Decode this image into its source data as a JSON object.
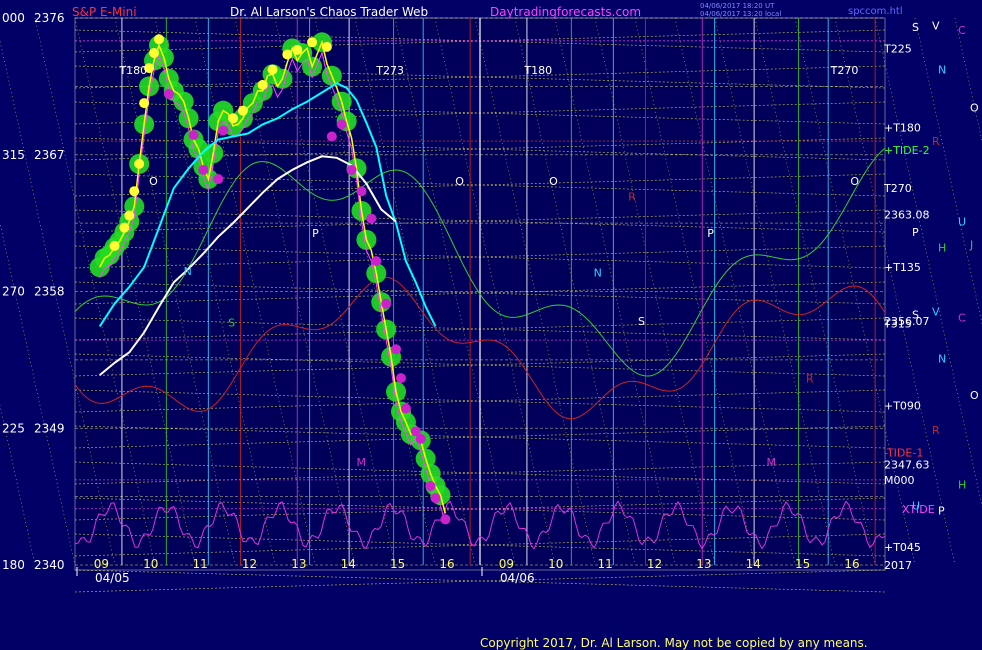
{
  "header": {
    "instrument": "S&P E-Mini",
    "site": "Dr. Al Larson's Chaos Trader Web",
    "url": "Daytradingforecasts.com",
    "stamp1": "04/06/2017 18:20 UT",
    "stamp2": "04/06/2017 13:20 local",
    "file": "spccom.htl"
  },
  "footer": {
    "copyright": "Copyright 2017, Dr. Al Larson. May not be copied by any means."
  },
  "colors": {
    "background": "#000066",
    "price": "#ffff00",
    "ma_fast": "#00ffff",
    "ma_slow": "#ffffff",
    "green_marker": "#22dd22",
    "yellow_marker": "#ffff33",
    "magenta_marker": "#cc22cc",
    "red_line": "#cc2222",
    "green_line": "#33cc33",
    "xtide": "#dd33dd",
    "grid_yellow": "#dddd55"
  },
  "chart_data": {
    "type": "line",
    "y_left_labels": [
      {
        "angle": "000",
        "price": "2376"
      },
      {
        "angle": "315",
        "price": "2367"
      },
      {
        "angle": "270",
        "price": "2358"
      },
      {
        "angle": "225",
        "price": "2349"
      },
      {
        "angle": "180",
        "price": "2340"
      }
    ],
    "ylim": [
      2340,
      2376
    ],
    "days": [
      {
        "date": "04/05",
        "hours": [
          "09",
          "10",
          "11",
          "12",
          "13",
          "14",
          "15",
          "16"
        ]
      },
      {
        "date": "04/06",
        "hours": [
          "09",
          "10",
          "11",
          "12",
          "13",
          "14",
          "15",
          "16"
        ]
      }
    ],
    "right_labels": [
      {
        "text": "T225",
        "price": 2374.0
      },
      {
        "text": "+T180",
        "price": 2368.8
      },
      {
        "text": "+TIDE-2",
        "price": 2367.3
      },
      {
        "text": "T270",
        "price": 2364.8
      },
      {
        "text": "2363.08",
        "price": 2363.08
      },
      {
        "text": "+T135",
        "price": 2359.6
      },
      {
        "text": "2356.07",
        "price": 2356.07
      },
      {
        "text": "T315",
        "price": 2355.9
      },
      {
        "text": "+T090",
        "price": 2350.5
      },
      {
        "text": "-TIDE-1",
        "price": 2347.4
      },
      {
        "text": "2347.63",
        "price": 2346.6
      },
      {
        "text": "M000",
        "price": 2345.6
      },
      {
        "text": "XTIDE",
        "price": 2343.7
      },
      {
        "text": "+T045",
        "price": 2341.2
      },
      {
        "text": "2017",
        "price": 2340.0
      }
    ],
    "planet_labels": [
      {
        "text": "V",
        "color": "#ffffff",
        "price": 2375.5
      },
      {
        "text": "C",
        "color": "#cc33cc",
        "price": 2375.2
      },
      {
        "text": "S",
        "color": "#ffffff",
        "price": 2375.4
      },
      {
        "text": "N",
        "color": "#33ccff",
        "price": 2372.6
      },
      {
        "text": "O",
        "color": "#ffffff",
        "price": 2370.1
      },
      {
        "text": "R",
        "color": "#cc2222",
        "price": 2367.9
      },
      {
        "text": "U",
        "color": "#33ccff",
        "price": 2362.6
      },
      {
        "text": "P",
        "color": "#ffffff",
        "price": 2361.9
      },
      {
        "text": "H",
        "color": "#33cc33",
        "price": 2360.9
      },
      {
        "text": "J",
        "color": "#33cc33",
        "price": 2361.1
      },
      {
        "text": "V",
        "color": "#33ccff",
        "price": 2356.7
      },
      {
        "text": "C",
        "color": "#cc33cc",
        "price": 2356.3
      },
      {
        "text": "S",
        "color": "#ffffff",
        "price": 2356.5
      },
      {
        "text": "N",
        "color": "#33ccff",
        "price": 2353.6
      },
      {
        "text": "O",
        "color": "#ffffff",
        "price": 2351.2
      },
      {
        "text": "R",
        "color": "#cc2222",
        "price": 2348.9
      },
      {
        "text": "H",
        "color": "#33cc33",
        "price": 2345.3
      },
      {
        "text": "U",
        "color": "#33ccff",
        "price": 2343.9
      },
      {
        "text": "P",
        "color": "#ffffff",
        "price": 2343.6
      }
    ],
    "chart_letters": [
      {
        "text": "T180",
        "color": "#ffffff",
        "day": 0,
        "hour": 9.4,
        "price": 2372.3
      },
      {
        "text": "T273",
        "color": "#ffffff",
        "day": 0,
        "hour": 14.6,
        "price": 2372.3
      },
      {
        "text": "T180",
        "color": "#ffffff",
        "day": 1,
        "hour": 9.4,
        "price": 2372.3
      },
      {
        "text": "T270",
        "color": "#ffffff",
        "day": 1,
        "hour": 15.6,
        "price": 2372.3
      },
      {
        "text": "O",
        "color": "#ffffff",
        "day": 0,
        "hour": 10.0,
        "price": 2365.0
      },
      {
        "text": "O",
        "color": "#ffffff",
        "day": 0,
        "hour": 16.2,
        "price": 2365.0
      },
      {
        "text": "O",
        "color": "#ffffff",
        "day": 1,
        "hour": 9.9,
        "price": 2365.0
      },
      {
        "text": "O",
        "color": "#ffffff",
        "day": 1,
        "hour": 16.0,
        "price": 2365.0
      },
      {
        "text": "N",
        "color": "#33ccff",
        "day": 0,
        "hour": 10.7,
        "price": 2359.1
      },
      {
        "text": "P",
        "color": "#ffffff",
        "day": 0,
        "hour": 13.3,
        "price": 2361.6
      },
      {
        "text": "S",
        "color": "#33cc33",
        "day": 0,
        "hour": 11.6,
        "price": 2355.7
      },
      {
        "text": "N",
        "color": "#33ccff",
        "day": 1,
        "hour": 10.8,
        "price": 2359.0
      },
      {
        "text": "S",
        "color": "#ffffff",
        "day": 1,
        "hour": 11.7,
        "price": 2355.8
      },
      {
        "text": "P",
        "color": "#ffffff",
        "day": 1,
        "hour": 13.1,
        "price": 2361.6
      },
      {
        "text": "M",
        "color": "#cc33cc",
        "day": 0,
        "hour": 14.2,
        "price": 2346.5
      },
      {
        "text": "M",
        "color": "#cc33cc",
        "day": 1,
        "hour": 14.3,
        "price": 2346.5
      },
      {
        "text": "R",
        "color": "#cc2222",
        "day": 1,
        "hour": 15.1,
        "price": 2352.0
      },
      {
        "text": "R",
        "color": "#cc2222",
        "day": 1,
        "hour": 11.5,
        "price": 2364.0
      }
    ],
    "series": [
      {
        "role": "price",
        "points": [
          [
            9.0,
            2359.6
          ],
          [
            9.1,
            2360.2
          ],
          [
            9.2,
            2360.4
          ],
          [
            9.3,
            2360.9
          ],
          [
            9.4,
            2361.3
          ],
          [
            9.5,
            2361.9
          ],
          [
            9.6,
            2362.6
          ],
          [
            9.7,
            2363.6
          ],
          [
            9.8,
            2366.4
          ],
          [
            9.9,
            2369.0
          ],
          [
            10.0,
            2371.5
          ],
          [
            10.1,
            2373.2
          ],
          [
            10.2,
            2374.2
          ],
          [
            10.3,
            2373.4
          ],
          [
            10.4,
            2372.0
          ],
          [
            10.5,
            2371.2
          ],
          [
            10.6,
            2371.0
          ],
          [
            10.7,
            2370.5
          ],
          [
            10.8,
            2369.4
          ],
          [
            10.9,
            2368.0
          ],
          [
            11.0,
            2367.4
          ],
          [
            11.1,
            2366.2
          ],
          [
            11.2,
            2365.4
          ],
          [
            11.3,
            2367.1
          ],
          [
            11.4,
            2369.2
          ],
          [
            11.5,
            2369.9
          ],
          [
            11.6,
            2369.7
          ],
          [
            11.7,
            2368.9
          ],
          [
            11.8,
            2369.0
          ],
          [
            11.9,
            2369.4
          ],
          [
            12.0,
            2370.1
          ],
          [
            12.1,
            2370.4
          ],
          [
            12.2,
            2371.2
          ],
          [
            12.3,
            2371.2
          ],
          [
            12.4,
            2372.2
          ],
          [
            12.5,
            2372.3
          ],
          [
            12.6,
            2371.5
          ],
          [
            12.7,
            2372.0
          ],
          [
            12.8,
            2373.1
          ],
          [
            12.9,
            2374.0
          ],
          [
            13.0,
            2373.2
          ],
          [
            13.1,
            2373.7
          ],
          [
            13.2,
            2374.0
          ],
          [
            13.3,
            2372.8
          ],
          [
            13.4,
            2373.6
          ],
          [
            13.5,
            2374.4
          ],
          [
            13.6,
            2373.0
          ],
          [
            13.7,
            2372.2
          ],
          [
            13.8,
            2371.4
          ],
          [
            13.9,
            2370.5
          ],
          [
            14.0,
            2369.2
          ],
          [
            14.1,
            2368.1
          ],
          [
            14.2,
            2366.1
          ],
          [
            14.3,
            2363.3
          ],
          [
            14.4,
            2361.4
          ],
          [
            14.5,
            2360.7
          ],
          [
            14.6,
            2359.2
          ],
          [
            14.7,
            2357.3
          ],
          [
            14.8,
            2355.5
          ],
          [
            14.9,
            2353.7
          ],
          [
            15.0,
            2351.4
          ],
          [
            15.1,
            2350.1
          ],
          [
            15.2,
            2349.4
          ],
          [
            15.3,
            2348.6
          ],
          [
            15.4,
            2349.1
          ],
          [
            15.5,
            2348.2
          ],
          [
            15.6,
            2347.0
          ],
          [
            15.7,
            2346.0
          ],
          [
            15.8,
            2345.2
          ],
          [
            15.9,
            2344.6
          ],
          [
            16.0,
            2343.4
          ]
        ]
      },
      {
        "role": "ma_fast",
        "points": [
          [
            9.0,
            2355.7
          ],
          [
            9.3,
            2357.2
          ],
          [
            9.6,
            2358.3
          ],
          [
            9.9,
            2359.6
          ],
          [
            10.2,
            2362.2
          ],
          [
            10.5,
            2364.8
          ],
          [
            10.8,
            2366.1
          ],
          [
            11.1,
            2367.2
          ],
          [
            11.4,
            2368.0
          ],
          [
            11.7,
            2368.2
          ],
          [
            12.0,
            2368.4
          ],
          [
            12.3,
            2369.0
          ],
          [
            12.6,
            2369.4
          ],
          [
            12.9,
            2370.0
          ],
          [
            13.2,
            2370.5
          ],
          [
            13.5,
            2371.1
          ],
          [
            13.8,
            2371.7
          ],
          [
            14.0,
            2371.4
          ],
          [
            14.2,
            2370.6
          ],
          [
            14.4,
            2369.1
          ],
          [
            14.6,
            2367.5
          ],
          [
            14.8,
            2364.3
          ],
          [
            15.0,
            2362.5
          ],
          [
            15.2,
            2360.0
          ],
          [
            15.4,
            2358.6
          ],
          [
            15.6,
            2357.0
          ],
          [
            15.8,
            2355.7
          ]
        ]
      },
      {
        "role": "ma_slow",
        "points": [
          [
            9.0,
            2352.5
          ],
          [
            9.3,
            2353.3
          ],
          [
            9.6,
            2354.0
          ],
          [
            9.9,
            2355.3
          ],
          [
            10.2,
            2357.0
          ],
          [
            10.5,
            2358.6
          ],
          [
            10.8,
            2359.5
          ],
          [
            11.1,
            2360.5
          ],
          [
            11.4,
            2361.6
          ],
          [
            11.7,
            2362.5
          ],
          [
            12.0,
            2363.5
          ],
          [
            12.3,
            2364.5
          ],
          [
            12.6,
            2365.4
          ],
          [
            12.9,
            2366.0
          ],
          [
            13.2,
            2366.5
          ],
          [
            13.5,
            2366.9
          ],
          [
            13.8,
            2366.8
          ],
          [
            14.1,
            2366.3
          ],
          [
            14.4,
            2365.1
          ],
          [
            14.7,
            2363.4
          ],
          [
            15.0,
            2362.6
          ]
        ]
      }
    ],
    "green_markers": [
      [
        9.0,
        2359.6
      ],
      [
        9.1,
        2360.2
      ],
      [
        9.2,
        2360.4
      ],
      [
        9.3,
        2360.9
      ],
      [
        9.4,
        2361.3
      ],
      [
        9.5,
        2361.9
      ],
      [
        9.6,
        2362.6
      ],
      [
        9.7,
        2363.6
      ],
      [
        9.8,
        2366.4
      ],
      [
        9.9,
        2369.0
      ],
      [
        10.0,
        2371.5
      ],
      [
        10.1,
        2373.2
      ],
      [
        10.2,
        2374.2
      ],
      [
        10.3,
        2373.4
      ],
      [
        10.4,
        2372.0
      ],
      [
        10.5,
        2371.2
      ],
      [
        10.7,
        2370.5
      ],
      [
        10.8,
        2369.4
      ],
      [
        10.9,
        2368.0
      ],
      [
        11.0,
        2367.4
      ],
      [
        11.1,
        2366.2
      ],
      [
        11.2,
        2365.4
      ],
      [
        11.3,
        2367.1
      ],
      [
        11.4,
        2369.2
      ],
      [
        11.5,
        2369.9
      ],
      [
        11.7,
        2368.9
      ],
      [
        11.9,
        2369.4
      ],
      [
        12.1,
        2370.4
      ],
      [
        12.3,
        2371.2
      ],
      [
        12.5,
        2372.3
      ],
      [
        12.7,
        2372.0
      ],
      [
        12.9,
        2374.0
      ],
      [
        13.1,
        2373.7
      ],
      [
        13.3,
        2372.8
      ],
      [
        13.5,
        2374.4
      ],
      [
        13.7,
        2372.2
      ],
      [
        13.9,
        2370.5
      ],
      [
        14.0,
        2369.2
      ],
      [
        14.2,
        2366.1
      ],
      [
        14.3,
        2363.3
      ],
      [
        14.4,
        2361.4
      ],
      [
        14.6,
        2359.2
      ],
      [
        14.7,
        2357.3
      ],
      [
        14.8,
        2355.5
      ],
      [
        14.9,
        2353.7
      ],
      [
        15.0,
        2351.4
      ],
      [
        15.1,
        2350.1
      ],
      [
        15.2,
        2349.4
      ],
      [
        15.3,
        2348.6
      ],
      [
        15.5,
        2348.2
      ],
      [
        15.6,
        2347.0
      ],
      [
        15.7,
        2346.0
      ],
      [
        15.8,
        2345.2
      ],
      [
        15.9,
        2344.6
      ]
    ],
    "yellow_markers": [
      [
        9.3,
        2361.0
      ],
      [
        9.5,
        2362.2
      ],
      [
        9.6,
        2363.0
      ],
      [
        9.7,
        2364.6
      ],
      [
        9.8,
        2366.4
      ],
      [
        9.9,
        2370.4
      ],
      [
        10.0,
        2372.7
      ],
      [
        10.1,
        2373.7
      ],
      [
        10.2,
        2374.6
      ],
      [
        11.7,
        2369.4
      ],
      [
        11.9,
        2369.9
      ],
      [
        12.3,
        2371.6
      ],
      [
        12.5,
        2372.6
      ],
      [
        12.8,
        2373.6
      ],
      [
        13.0,
        2373.9
      ],
      [
        13.3,
        2374.4
      ],
      [
        13.6,
        2374.1
      ]
    ],
    "magenta_markers": [
      [
        10.4,
        2371.0
      ],
      [
        10.9,
        2368.3
      ],
      [
        11.1,
        2366.0
      ],
      [
        11.4,
        2365.4
      ],
      [
        11.5,
        2368.6
      ],
      [
        13.7,
        2368.2
      ],
      [
        13.9,
        2369.0
      ],
      [
        14.1,
        2366.0
      ],
      [
        14.3,
        2364.6
      ],
      [
        14.5,
        2362.8
      ],
      [
        14.6,
        2360.0
      ],
      [
        14.8,
        2357.2
      ],
      [
        15.0,
        2354.2
      ],
      [
        15.1,
        2352.3
      ],
      [
        15.2,
        2350.3
      ],
      [
        15.4,
        2348.8
      ],
      [
        15.5,
        2348.3
      ],
      [
        15.7,
        2345.2
      ],
      [
        15.8,
        2344.4
      ],
      [
        16.0,
        2343.0
      ]
    ]
  }
}
